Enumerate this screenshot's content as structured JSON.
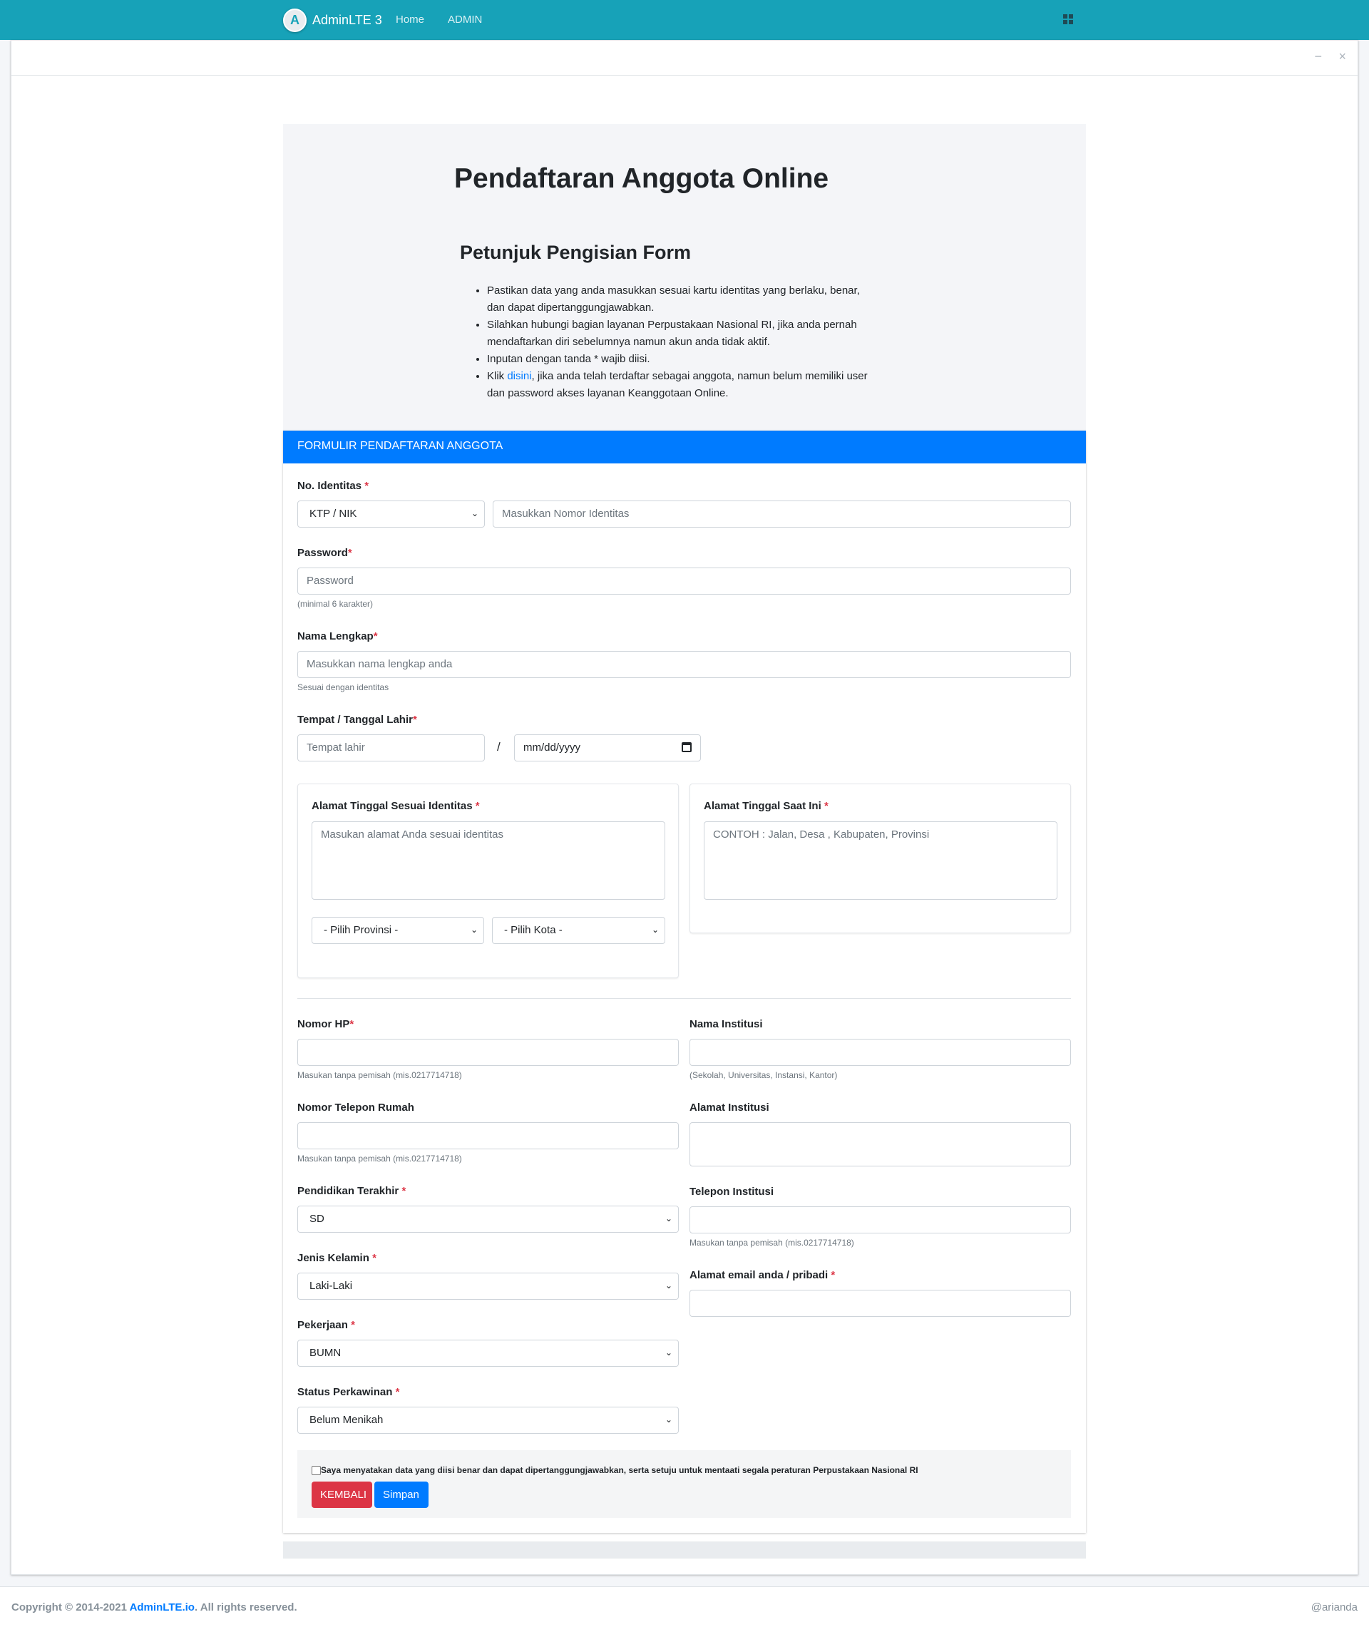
{
  "navbar": {
    "brand": "AdminLTE 3",
    "logo_letter": "A",
    "links": [
      "Home",
      "ADMIN"
    ],
    "apps_icon": "grid-icon"
  },
  "card_tools": {
    "minimize": "−",
    "close": "×"
  },
  "intro": {
    "title": "Pendaftaran Anggota Online",
    "subtitle": "Petunjuk Pengisian Form",
    "bullets": [
      "Pastikan data yang anda masukkan sesuai kartu identitas yang berlaku, benar, dan dapat dipertanggungjawabkan.",
      "Silahkan hubungi bagian layanan Perpustakaan Nasional RI, jika anda pernah mendaftarkan diri sebelumnya namun akun anda tidak aktif.",
      "Inputan dengan tanda * wajib diisi."
    ],
    "bullet4_prefix": "Klik ",
    "bullet4_link": "disini",
    "bullet4_suffix": ", jika anda telah terdaftar sebagai anggota, namun belum memiliki user dan password akses layanan Keanggotaan Online."
  },
  "form": {
    "header": "FORMULIR PENDAFTARAN ANGGOTA",
    "required_mark": "*",
    "identitas": {
      "label": "No. Identitas",
      "type_value": "KTP / NIK",
      "placeholder": "Masukkan Nomor Identitas"
    },
    "password": {
      "label": "Password",
      "placeholder": "Password",
      "hint": "(minimal 6 karakter)"
    },
    "nama": {
      "label": "Nama Lengkap",
      "placeholder": "Masukkan nama lengkap anda",
      "hint": "Sesuai dengan identitas"
    },
    "ttl": {
      "label": "Tempat / Tanggal Lahir",
      "place_placeholder": "Tempat lahir",
      "separator": "/",
      "date_placeholder": "mm/dd/yyyy"
    },
    "alamat_identitas": {
      "label": "Alamat Tinggal Sesuai Identitas",
      "placeholder": "Masukan alamat Anda sesuai identitas",
      "provinsi": "- Pilih Provinsi -",
      "kota": "- Pilih Kota -"
    },
    "alamat_saat_ini": {
      "label": "Alamat Tinggal Saat Ini",
      "placeholder": "CONTOH : Jalan, Desa , Kabupaten, Provinsi"
    },
    "nomor_hp": {
      "label": "Nomor HP",
      "hint": "Masukan tanpa pemisah (mis.0217714718)"
    },
    "telepon_rumah": {
      "label": "Nomor Telepon Rumah",
      "hint": "Masukan tanpa pemisah (mis.0217714718)"
    },
    "pendidikan": {
      "label": "Pendidikan Terakhir",
      "value": "SD"
    },
    "jenis_kelamin": {
      "label": "Jenis Kelamin",
      "value": "Laki-Laki"
    },
    "pekerjaan": {
      "label": "Pekerjaan",
      "value": "BUMN"
    },
    "status_perkawinan": {
      "label": "Status Perkawinan",
      "value": "Belum Menikah"
    },
    "nama_institusi": {
      "label": "Nama Institusi",
      "hint": "(Sekolah, Universitas, Instansi, Kantor)"
    },
    "alamat_institusi": {
      "label": "Alamat Institusi"
    },
    "telepon_institusi": {
      "label": "Telepon Institusi",
      "hint": "Masukan tanpa pemisah (mis.0217714718)"
    },
    "email": {
      "label": "Alamat email anda / pribadi"
    },
    "agreement": "Saya menyatakan data yang diisi benar dan dapat dipertanggungjawabkan, serta setuju untuk mentaati segala peraturan Perpustakaan Nasional RI",
    "btn_back": "KEMBALI",
    "btn_save": "Simpan"
  },
  "footer": {
    "copyright_prefix": "Copyright © 2014-2021 ",
    "copyright_link": "AdminLTE.io",
    "copyright_suffix": ". All rights reserved.",
    "right": "@arianda"
  },
  "colors": {
    "navbar": "#17a2b8",
    "primary": "#007bff",
    "danger": "#dc3545"
  }
}
